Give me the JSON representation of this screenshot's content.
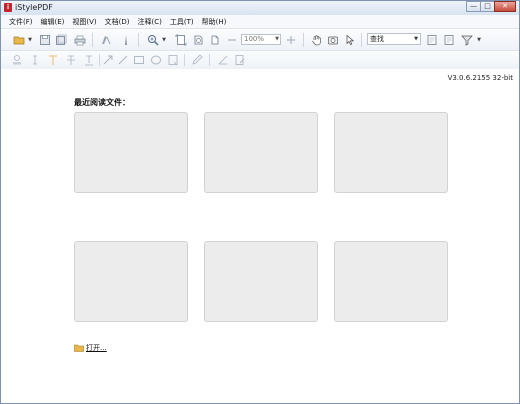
{
  "window": {
    "title": "iStylePDF",
    "app_icon": "pdf-app-icon"
  },
  "window_controls": {
    "minimize": "—",
    "maximize": "□",
    "close": "✕"
  },
  "menu": [
    {
      "label": "文件(F)"
    },
    {
      "label": "编辑(E)"
    },
    {
      "label": "视图(V)"
    },
    {
      "label": "文档(D)"
    },
    {
      "label": "注释(C)"
    },
    {
      "label": "工具(T)"
    },
    {
      "label": "帮助(H)"
    }
  ],
  "toolbar": {
    "zoom_value": "100%",
    "find_label": "查找"
  },
  "content": {
    "version": "V3.0.6.2155 32-bit",
    "recent_title": "最近阅读文件：",
    "open_label": "打开..."
  },
  "colors": {
    "title_gradient": "#d7e3f1",
    "close_button": "#c94a3a",
    "thumb_fill": "#ececec",
    "folder": "#e8b84a"
  }
}
